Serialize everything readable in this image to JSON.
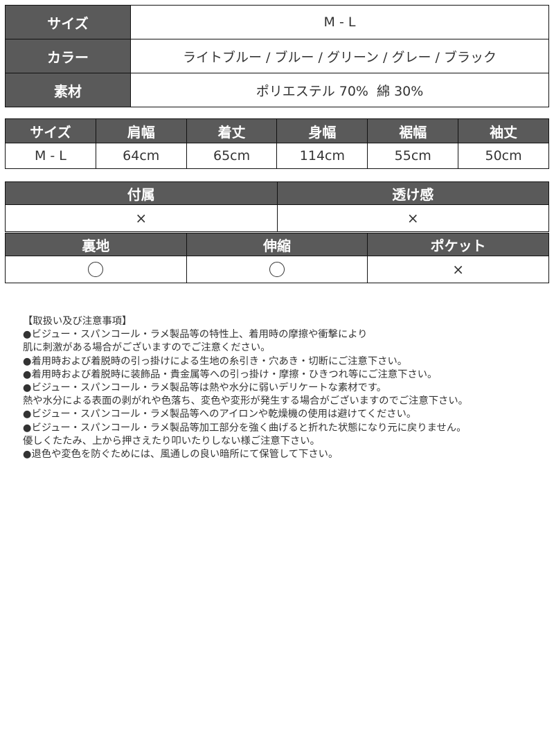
{
  "spec_table": {
    "rows": [
      {
        "label": "サイズ",
        "value": "M - L"
      },
      {
        "label": "カラー",
        "value": "ライトブルー / ブルー / グリーン / グレー / ブラック"
      },
      {
        "label": "素材",
        "value": "ポリエステル 70%  綿 30%"
      }
    ]
  },
  "size_table": {
    "headers": [
      "サイズ",
      "肩幅",
      "着丈",
      "身幅",
      "裾幅",
      "袖丈"
    ],
    "values": [
      "M - L",
      "64cm",
      "65cm",
      "114cm",
      "55cm",
      "50cm"
    ]
  },
  "attribute_table": {
    "row1": {
      "headers": [
        "付属",
        "透け感"
      ],
      "values": [
        "×",
        "×"
      ],
      "marks": [
        "x",
        "x"
      ]
    },
    "row2": {
      "headers": [
        "裏地",
        "伸縮",
        "ポケット"
      ],
      "values": [
        "○",
        "○",
        "×"
      ],
      "marks": [
        "o",
        "o",
        "x"
      ]
    }
  },
  "notes": {
    "title": "【取扱い及び注意事項】",
    "lines": [
      "●ビジュー・スパンコール・ラメ製品等の特性上、着用時の摩擦や衝撃により",
      "肌に刺激がある場合がございますのでご注意ください。",
      "●着用時および着脱時の引っ掛けによる生地の糸引き・穴あき・切断にご注意下さい。",
      "●着用時および着脱時に装飾品・貴金属等への引っ掛け・摩擦・ひきつれ等にご注意下さい。",
      "●ビジュー・スパンコール・ラメ製品等は熱や水分に弱いデリケートな素材です。",
      "熱や水分による表面の剥がれや色落ち、変色や変形が発生する場合がございますのでご注意下さい。",
      "●ビジュー・スパンコール・ラメ製品等へのアイロンや乾燥機の使用は避けてください。",
      "●ビジュー・スパンコール・ラメ製品等加工部分を強く曲げると折れた状態になり元に戻りません。",
      "優しくたたみ、上から押さえたり叩いたりしない様ご注意下さい。",
      "●退色や変色を防ぐためには、風通しの良い暗所にて保管して下さい。"
    ]
  }
}
